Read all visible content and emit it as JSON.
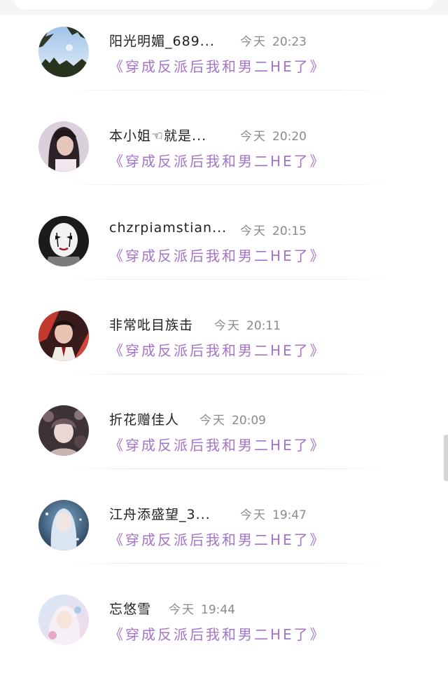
{
  "messages": [
    {
      "name": "阳光明媚_689...",
      "day": "今天",
      "time": "20:23",
      "book": "《穿成反派后我和男二HE了》",
      "avatar": "sky-trees-avatar"
    },
    {
      "name": "本小姐☜就是...",
      "day": "今天",
      "time": "20:20",
      "book": "《穿成反派后我和男二HE了》",
      "avatar": "girl-hair-avatar"
    },
    {
      "name": "chzrpiamstian...",
      "day": "今天",
      "time": "20:15",
      "book": "《穿成反派后我和男二HE了》",
      "avatar": "mask-avatar"
    },
    {
      "name": "非常吡目族击",
      "day": "今天",
      "time": "20:11",
      "book": "《穿成反派后我和男二HE了》",
      "avatar": "red-boy-avatar"
    },
    {
      "name": "折花赠佳人",
      "day": "今天",
      "time": "20:09",
      "book": "《穿成反派后我和男二HE了》",
      "avatar": "dark-anime-avatar"
    },
    {
      "name": "江舟添盛望_3...",
      "day": "今天",
      "time": "19:47",
      "book": "《穿成反派后我和男二HE了》",
      "avatar": "blue-elf-avatar"
    },
    {
      "name": "忘悠雪",
      "day": "今天",
      "time": "19:44",
      "book": "《穿成反派后我和男二HE了》",
      "avatar": "pastel-anime-avatar"
    }
  ],
  "colors": {
    "book_title": "#a374c9",
    "name": "#222222",
    "time": "#8a8a8a"
  }
}
